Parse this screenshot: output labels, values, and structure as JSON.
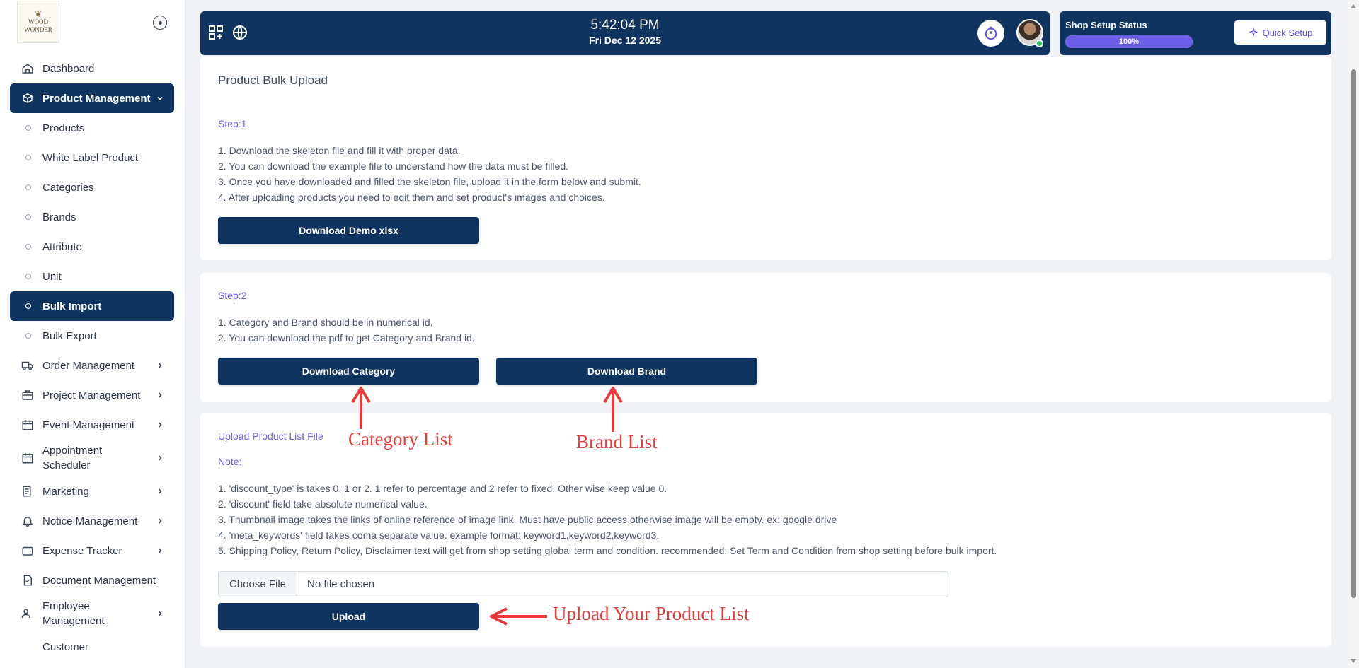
{
  "brand": {
    "logo_line1": "WOOD",
    "logo_line2": "WONDER"
  },
  "sidebar": {
    "items": [
      {
        "label": "Dashboard",
        "icon": "home-icon"
      },
      {
        "label": "Product Management",
        "icon": "box-icon",
        "expanded": true,
        "active": true
      },
      {
        "label": "Order Management",
        "icon": "truck-icon"
      },
      {
        "label": "Project Management",
        "icon": "briefcase-icon"
      },
      {
        "label": "Event Management",
        "icon": "calendar-icon"
      },
      {
        "label": "Appointment Scheduler",
        "icon": "calendar-clock-icon"
      },
      {
        "label": "Marketing",
        "icon": "megaphone-icon"
      },
      {
        "label": "Notice Management",
        "icon": "bell-icon"
      },
      {
        "label": "Expense Tracker",
        "icon": "wallet-icon"
      },
      {
        "label": "Document Management",
        "icon": "document-icon"
      },
      {
        "label": "Employee Management",
        "icon": "users-icon"
      },
      {
        "label": "Customer",
        "icon": "user-icon"
      }
    ],
    "sub_items": [
      "Products",
      "White Label Product",
      "Categories",
      "Brands",
      "Attribute",
      "Unit",
      "Bulk Import",
      "Bulk Export"
    ],
    "active_sub": "Bulk Import"
  },
  "topbar": {
    "time": "5:42:04 PM",
    "date": "Fri Dec 12 2025"
  },
  "setup": {
    "label": "Shop Setup Status",
    "progress": 100,
    "progress_text": "100%",
    "quick_setup": "Quick Setup"
  },
  "page": {
    "title": "Product Bulk Upload"
  },
  "step1": {
    "label": "Step:1",
    "instructions": [
      "Download the skeleton file and fill it with proper data.",
      "You can download the example file to understand how the data must be filled.",
      "Once you have downloaded and filled the skeleton file, upload it in the form below and submit.",
      "After uploading products you need to edit them and set product's images and choices."
    ],
    "button": "Download Demo xlsx"
  },
  "step2": {
    "label": "Step:2",
    "instructions": [
      "Category and Brand should be in numerical id.",
      "You can download the pdf to get Category and Brand id."
    ],
    "category_button": "Download Category",
    "brand_button": "Download Brand"
  },
  "upload": {
    "label": "Upload Product List File",
    "note_label": "Note:",
    "notes": [
      "'discount_type' is takes 0, 1 or 2. 1 refer to percentage and 2 refer to fixed. Other wise keep value 0.",
      "'discount' field take absolute numerical value.",
      "Thumbnail image takes the links of online reference of image link. Must have public access otherwise image will be empty. ex: google drive",
      "'meta_keywords' field takes coma separate value. example format: keyword1,keyword2,keyword3.",
      "Shipping Policy, Return Policy, Disclaimer text will get from shop setting global term and condition. recommended: Set Term and Condition from shop setting before bulk import."
    ],
    "choose_file": "Choose File",
    "no_file": "No file chosen",
    "button": "Upload"
  },
  "annotations": {
    "category": "Category List",
    "brand": "Brand List",
    "upload": "Upload Your Product  List"
  },
  "colors": {
    "primary": "#0f3460",
    "accent": "#6c5ce7",
    "annotation": "#ea3a3a",
    "online": "#22c55e"
  }
}
